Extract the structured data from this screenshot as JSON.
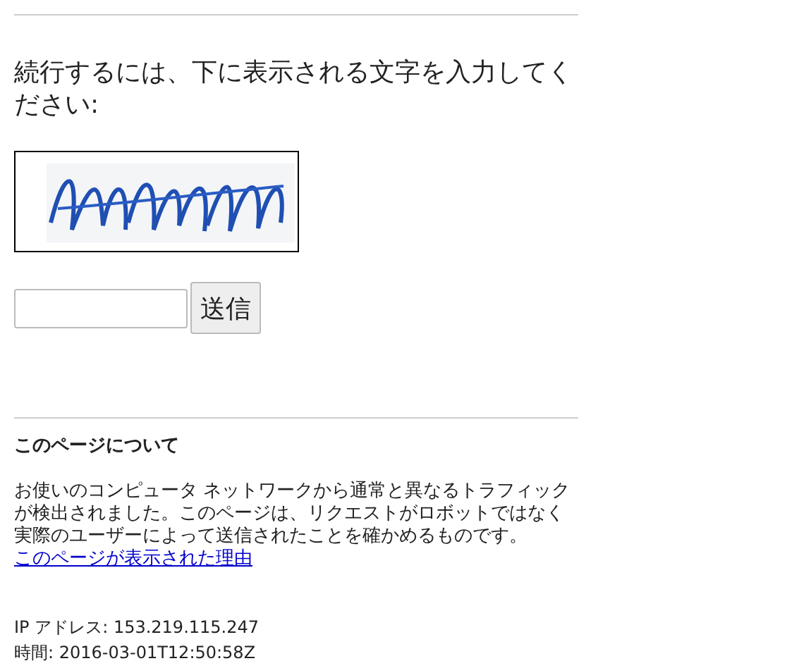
{
  "prompt": "続行するには、下に表示される文字を入力してください:",
  "submit_button": "送信",
  "about": {
    "title": "このページについて",
    "text": "お使いのコンピュータ ネットワークから通常と異なるトラフィックが検出されました。このページは、リクエストがロボットではなく実際のユーザーによって送信されたことを確かめるものです。",
    "link": "このページが表示された理由"
  },
  "info_lines": [
    "IP アドレス: 153.219.115.247",
    "時間: 2016-03-01T12:50:58Z"
  ]
}
